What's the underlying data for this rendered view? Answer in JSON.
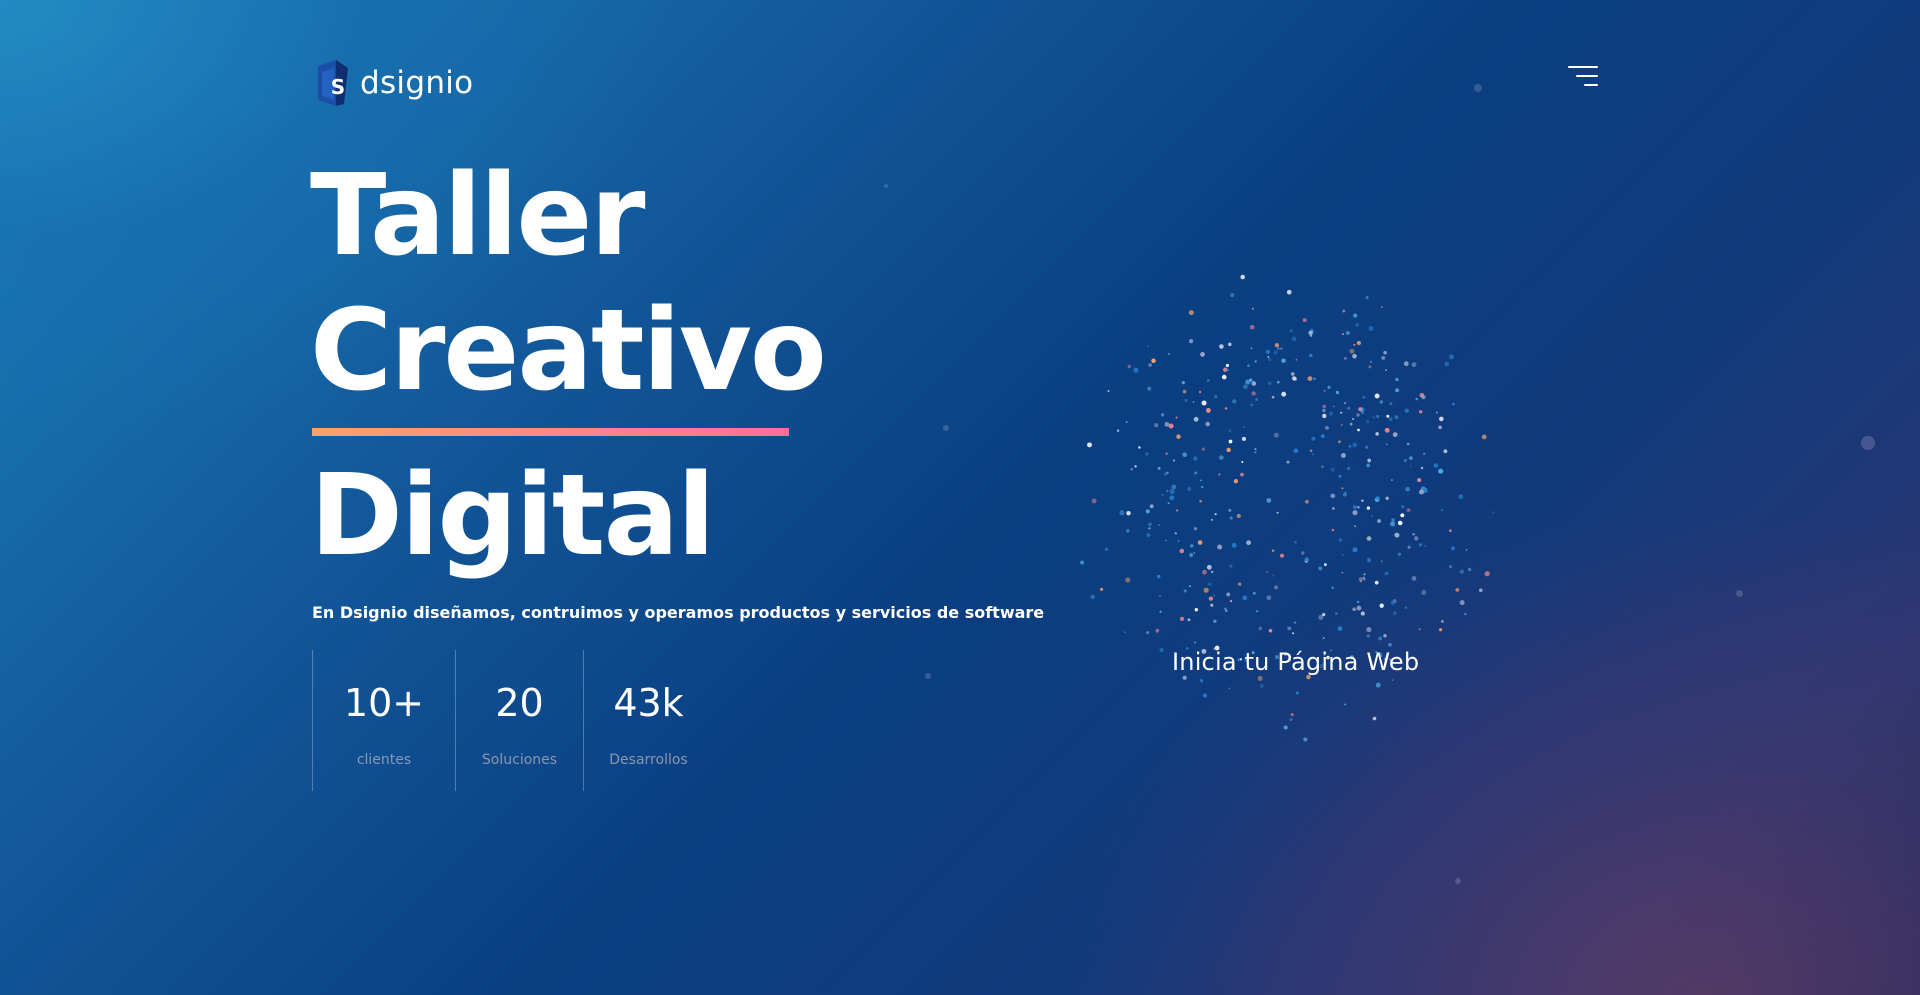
{
  "brand": {
    "name": "dsignio",
    "mark_letter": "S"
  },
  "header": {
    "menu_icon": "hamburger-menu-icon"
  },
  "hero": {
    "title_lines": [
      "Taller",
      "Creativo",
      "Digital"
    ],
    "subtitle": "En Dsignio diseñamos, contruimos y operamos productos y servicios de software",
    "underline_colors": [
      "#f7a36b",
      "#fb6f9a"
    ]
  },
  "stats": [
    {
      "value": "10+",
      "label": "clientes"
    },
    {
      "value": "20",
      "label": "Soluciones"
    },
    {
      "value": "43k",
      "label": "Desarrollos"
    }
  ],
  "cta": {
    "label": "Inicia tu Página Web"
  },
  "colors": {
    "background_start": "#1c82bb",
    "background_mid": "#0a3f82",
    "background_end": "#2b3772",
    "particle_colors": [
      "#ffffff",
      "#f48b8f",
      "#f7a36b",
      "#4fa3e0",
      "#2b7fd0",
      "#9aa4c8"
    ]
  }
}
